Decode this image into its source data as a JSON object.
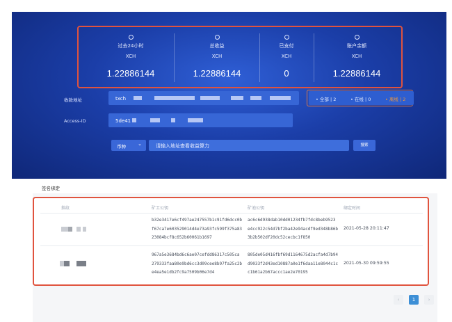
{
  "stats": [
    {
      "title": "过去24小时",
      "unit": "XCH",
      "value": "1.22886144",
      "icon": "clock-icon"
    },
    {
      "title": "总收益",
      "unit": "XCH",
      "value": "1.22886144",
      "icon": "check-circle-icon"
    },
    {
      "title": "已支付",
      "unit": "XCH",
      "value": "0",
      "icon": "pie-icon"
    },
    {
      "title": "账户余额",
      "unit": "XCH",
      "value": "1.22886144",
      "icon": "coin-icon"
    }
  ],
  "address": {
    "label": "收款地址",
    "value_prefix": "txch"
  },
  "access": {
    "label": "Access-ID",
    "value_prefix": "5de41"
  },
  "filter": {
    "all": "• 全部 | 2",
    "online": "• 在线 | 0",
    "offline": "• 离线 | 2"
  },
  "search": {
    "currency_label": "币种",
    "placeholder": "请输入地址查看收益算力",
    "button": "搜索"
  },
  "section": {
    "title": "签名绑定"
  },
  "table": {
    "headers": [
      "指纹",
      "矿工公钥",
      "矿池公钥",
      "绑定时间"
    ],
    "rows": [
      {
        "miner_key": [
          "b32e3417e6cf497ae247557b1c91fd6dcc0b",
          "f67ca7e603529014d4e73a93fc599f375a83",
          "23084bcf8c652b60061b1697"
        ],
        "pool_key": [
          "ac6c6d938dab10dd01234fb7fdc8beb9523",
          "e4cc922c54d7bf2ba42e94acdf9ed348b86b",
          "3b2b502df20dc52cecbc1f850"
        ],
        "time": "2021-05-28 20:11:47"
      },
      {
        "miner_key": [
          "967a5e3684bd6c6ae07cefdd86317c505ca",
          "279333faa80e9bd6cc3d09cee8b97fa25c2b",
          "e4ea5e1db2fc9a7509b06e7d4"
        ],
        "pool_key": [
          "805de05d416fbf69d1164675d2acfa4d7b94",
          "d9033f2d43ed10887a0e1f6daa11e8044c1c",
          "c1b61a2b67accc1ae2e70195"
        ],
        "time": "2021-05-30 09:59:55"
      }
    ]
  },
  "pagination": {
    "prev": "‹",
    "current": "1",
    "next": "›"
  },
  "colors": {
    "accent_red": "#e0533e",
    "hero_blue": "#1b3ea8",
    "page_active": "#3d8fd6",
    "offline_orange": "#f0983c"
  }
}
